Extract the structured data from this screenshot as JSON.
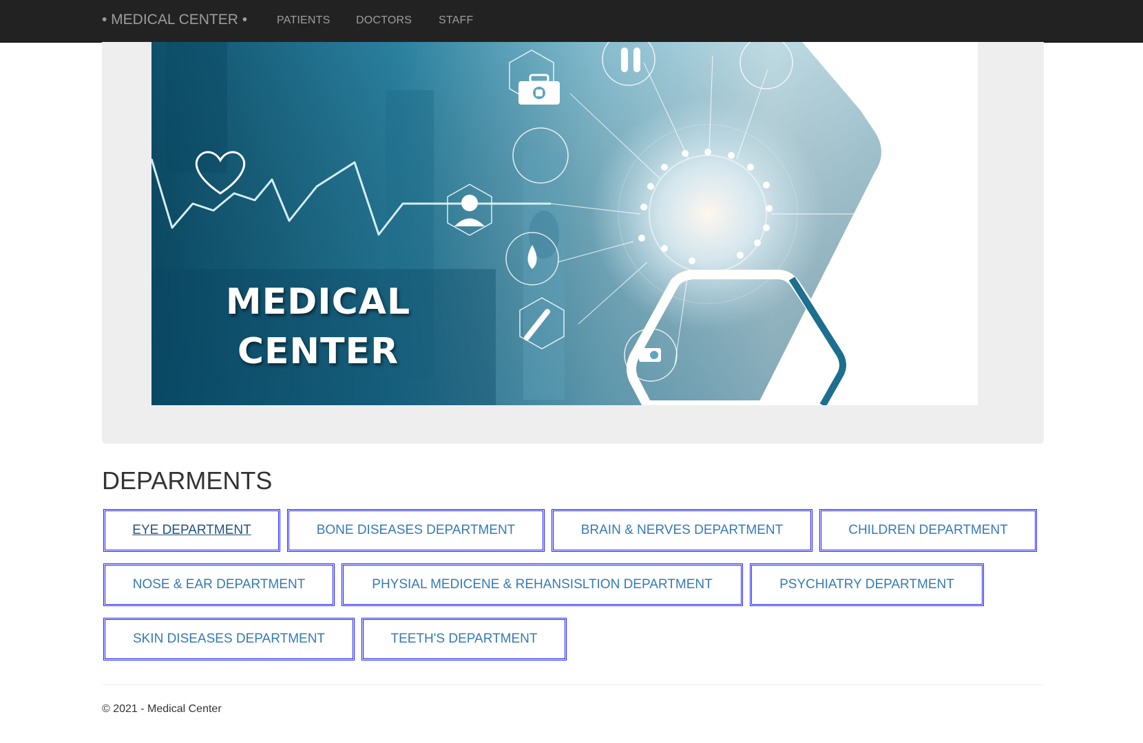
{
  "navbar": {
    "brand": "• MEDICAL CENTER •",
    "links": [
      "PATIENTS",
      "DOCTORS",
      "STAFF"
    ]
  },
  "hero": {
    "title_line1": "MEDICAL",
    "title_line2": "CENTER"
  },
  "departments": {
    "title": "DEPARMENTS",
    "items": [
      "EYE DEPARTMENT",
      "BONE DISEASES DEPARTMENT",
      "BRAIN & NERVES DEPARTMENT",
      "CHILDREN DEPARTMENT",
      "NOSE & EAR DEPARTMENT",
      "PHYSIAL MEDICENE & REHANSISLTION DEPARTMENT",
      "PSYCHIATRY DEPARTMENT",
      "SKIN DISEASES DEPARTMENT",
      "TEETH'S DEPARTMENT"
    ]
  },
  "footer": {
    "text": "© 2021 - Medical Center"
  },
  "colors": {
    "navbar": "#222222",
    "nav_text": "#9d9d9d",
    "link": "#337ab7",
    "button_border": "#1a1aff",
    "jumbotron": "#eeeeee"
  }
}
